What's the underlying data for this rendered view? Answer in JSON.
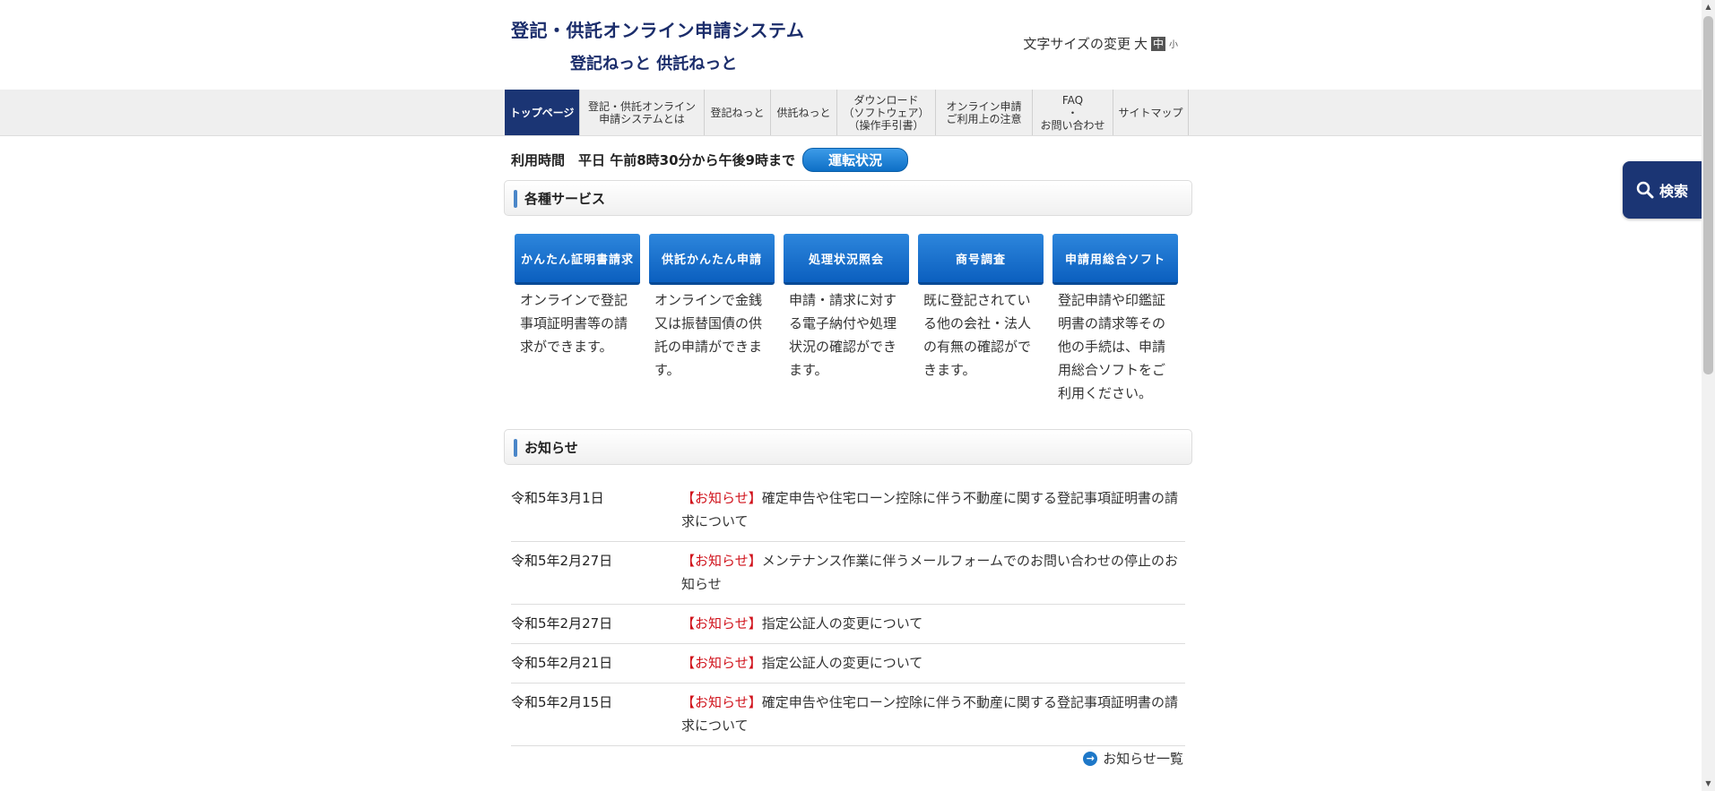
{
  "header": {
    "title_line1": "登記・供託オンライン申請システム",
    "title_line2": "登記ねっと 供託ねっと",
    "font_size_label": "文字サイズの変更",
    "font_size_large": "大",
    "font_size_medium": "中",
    "font_size_small": "小"
  },
  "nav": [
    {
      "label": "トップページ",
      "active": true
    },
    {
      "label": "登記・供託オンライン\n申請システムとは"
    },
    {
      "label": "登記ねっと"
    },
    {
      "label": "供託ねっと"
    },
    {
      "label": "ダウンロード\n（ソフトウェア）\n（操作手引書）"
    },
    {
      "label": "オンライン申請\nご利用上の注意"
    },
    {
      "label": "FAQ\n・\nお問い合わせ"
    },
    {
      "label": "サイトマップ"
    }
  ],
  "hours": {
    "label": "利用時間　平日 午前8時30分から午後9時まで",
    "status_button": "運転状況"
  },
  "services": {
    "heading": "各種サービス",
    "items": [
      {
        "button": "かんたん証明書請求",
        "desc": "オンラインで登記事項証明書等の請求ができます。"
      },
      {
        "button": "供託かんたん申請",
        "desc": "オンラインで金銭又は振替国債の供託の申請ができます。"
      },
      {
        "button": "処理状況照会",
        "desc": "申請・請求に対する電子納付や処理状況の確認ができます。"
      },
      {
        "button": "商号調査",
        "desc": "既に登記されている他の会社・法人の有無の確認ができます。"
      },
      {
        "button": "申請用総合ソフト",
        "desc": "登記申請や印鑑証明書の請求等その他の手続は、申請用総合ソフトをご利用ください。"
      }
    ]
  },
  "news": {
    "heading": "お知らせ",
    "tag": "【お知らせ】",
    "items": [
      {
        "date": "令和5年3月1日",
        "text": "確定申告や住宅ローン控除に伴う不動産に関する登記事項証明書の請求について"
      },
      {
        "date": "令和5年2月27日",
        "text": "メンテナンス作業に伴うメールフォームでのお問い合わせの停止のお知らせ"
      },
      {
        "date": "令和5年2月27日",
        "text": "指定公証人の変更について"
      },
      {
        "date": "令和5年2月21日",
        "text": "指定公証人の変更について"
      },
      {
        "date": "令和5年2月15日",
        "text": "確定申告や住宅ローン控除に伴う不動産に関する登記事項証明書の請求について"
      }
    ],
    "more_label": "お知らせ一覧"
  },
  "search_tab": {
    "label": "検索"
  },
  "colors": {
    "navy": "#1b3574",
    "accent_blue": "#0b5fbf",
    "tag_red": "#d0121b"
  }
}
